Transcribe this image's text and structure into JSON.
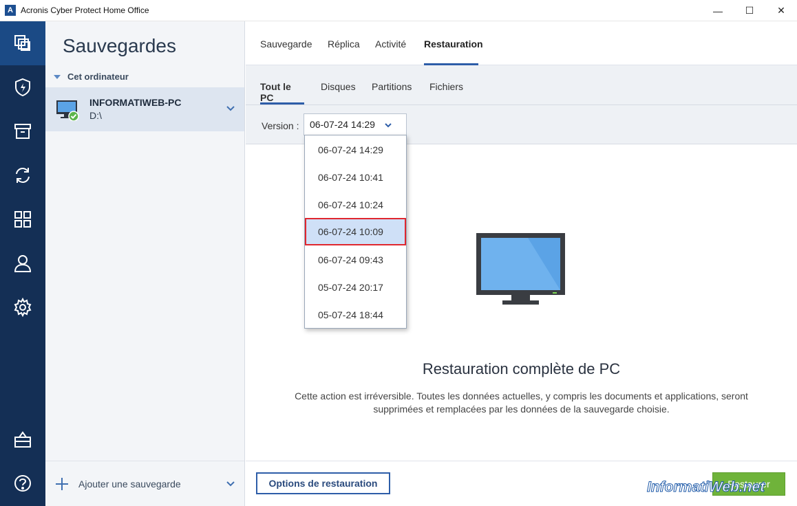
{
  "window": {
    "logo_letter": "A",
    "title": "Acronis Cyber Protect Home Office",
    "minimize": "—",
    "maximize": "☐",
    "close": "✕"
  },
  "rail": {
    "items": [
      "backups-icon",
      "protection-icon",
      "archive-icon",
      "sync-icon",
      "tools-icon",
      "account-icon",
      "settings-icon",
      "store-icon",
      "help-icon"
    ],
    "active": "backups-icon"
  },
  "panel": {
    "title": "Sauvegardes",
    "section": "Cet ordinateur",
    "backup": {
      "name": "INFORMATIWEB-PC",
      "drive": "D:\\"
    },
    "add_label": "Ajouter une sauvegarde"
  },
  "tabs": [
    {
      "label": "Sauvegarde",
      "active": false
    },
    {
      "label": "Réplica",
      "active": false
    },
    {
      "label": "Activité",
      "active": false
    },
    {
      "label": "Restauration",
      "active": true
    }
  ],
  "subtabs": [
    {
      "label": "Tout le PC",
      "active": true
    },
    {
      "label": "Disques",
      "active": false
    },
    {
      "label": "Partitions",
      "active": false
    },
    {
      "label": "Fichiers",
      "active": false
    }
  ],
  "version": {
    "label": "Version :",
    "selected": "06-07-24 14:29",
    "options": [
      "06-07-24 14:29",
      "06-07-24 10:41",
      "06-07-24 10:24",
      "06-07-24 10:09",
      "06-07-24 09:43",
      "05-07-24 20:17",
      "05-07-24 18:44"
    ],
    "highlighted": "06-07-24 10:09"
  },
  "content": {
    "title": "Restauration complète de PC",
    "description": "Cette action est irréversible. Toutes les données actuelles, y compris les documents et applications, seront supprimées et remplacées par les données de la sauvegarde choisie."
  },
  "footer": {
    "options_label": "Options de restauration",
    "restore_label": "Restaurer"
  },
  "watermark": "InformatiWeb.net",
  "colors": {
    "rail": "#142f55",
    "accent": "#2d5da8",
    "restore": "#6fb33a",
    "highlight_border": "#e0262e"
  }
}
